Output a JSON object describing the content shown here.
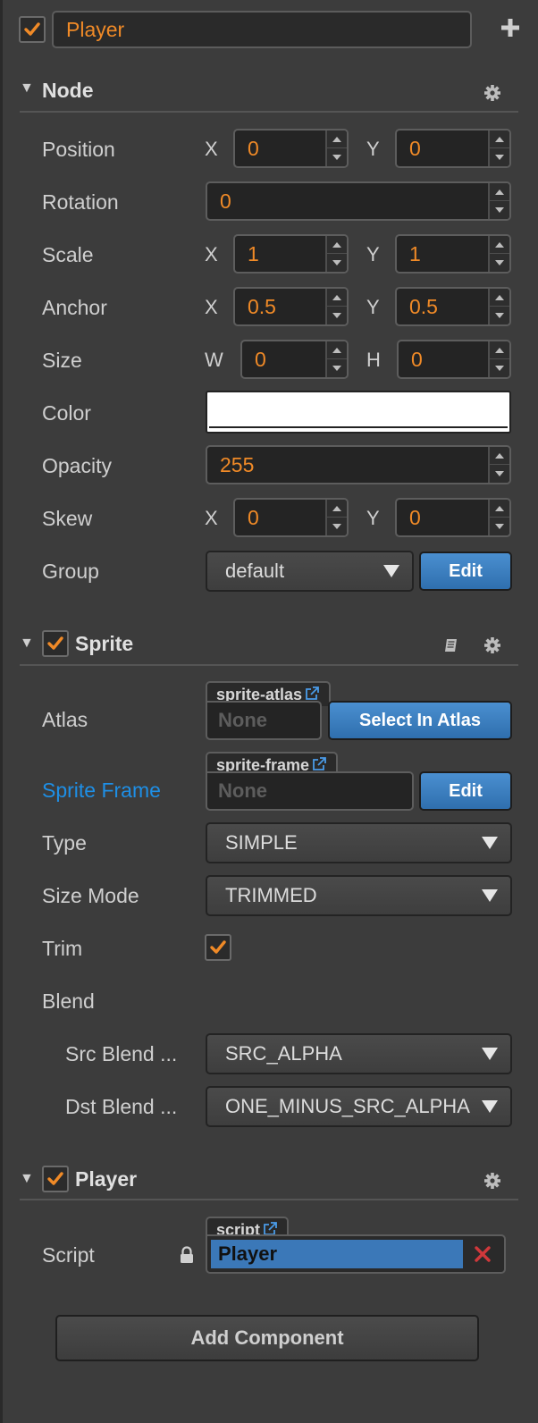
{
  "colors": {
    "accent": "#f08a27",
    "link_blue": "#1e8fe6",
    "button_blue": "#3b78b8",
    "remove_red": "#d0383b"
  },
  "header": {
    "node_name": "Player",
    "enabled": true
  },
  "node": {
    "title": "Node",
    "position": {
      "label": "Position",
      "x_label": "X",
      "x": "0",
      "y_label": "Y",
      "y": "0"
    },
    "rotation": {
      "label": "Rotation",
      "value": "0"
    },
    "scale": {
      "label": "Scale",
      "x_label": "X",
      "x": "1",
      "y_label": "Y",
      "y": "1"
    },
    "anchor": {
      "label": "Anchor",
      "x_label": "X",
      "x": "0.5",
      "y_label": "Y",
      "y": "0.5"
    },
    "size": {
      "label": "Size",
      "w_label": "W",
      "w": "0",
      "h_label": "H",
      "h": "0"
    },
    "color": {
      "label": "Color",
      "value": "#ffffff"
    },
    "opacity": {
      "label": "Opacity",
      "value": "255"
    },
    "skew": {
      "label": "Skew",
      "x_label": "X",
      "x": "0",
      "y_label": "Y",
      "y": "0"
    },
    "group": {
      "label": "Group",
      "value": "default",
      "edit_label": "Edit"
    }
  },
  "sprite": {
    "title": "Sprite",
    "enabled": true,
    "atlas": {
      "label": "Atlas",
      "tag": "sprite-atlas",
      "placeholder": "None",
      "button": "Select In Atlas"
    },
    "sprite_frame": {
      "label": "Sprite Frame",
      "tag": "sprite-frame",
      "placeholder": "None",
      "button": "Edit"
    },
    "type": {
      "label": "Type",
      "value": "SIMPLE"
    },
    "size_mode": {
      "label": "Size Mode",
      "value": "TRIMMED"
    },
    "trim": {
      "label": "Trim",
      "checked": true
    },
    "blend": {
      "label": "Blend"
    },
    "src_blend": {
      "label": "Src Blend ...",
      "value": "SRC_ALPHA"
    },
    "dst_blend": {
      "label": "Dst Blend ...",
      "value": "ONE_MINUS_SRC_ALPHA"
    }
  },
  "player": {
    "title": "Player",
    "enabled": true,
    "script": {
      "label": "Script",
      "tag": "script",
      "value": "Player"
    }
  },
  "add_component": "Add Component"
}
